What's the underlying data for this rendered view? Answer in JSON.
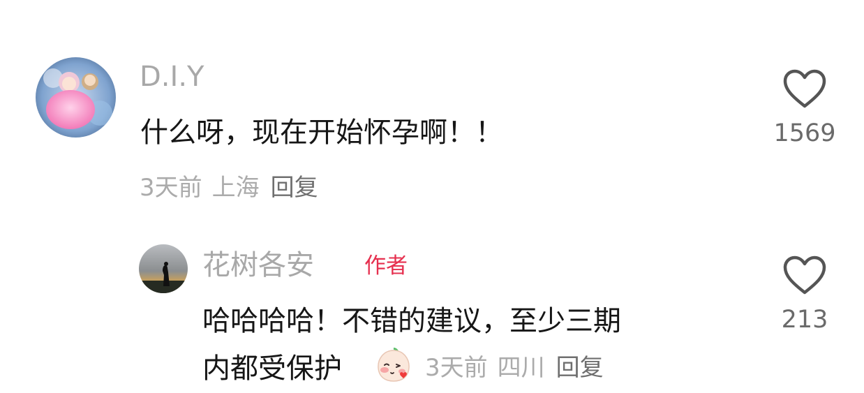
{
  "comments": [
    {
      "username": "D.I.Y",
      "text": "什么呀，现在开始怀孕啊！！",
      "time": "3天前",
      "location": "上海",
      "reply_label": "回复",
      "likes": "1569"
    }
  ],
  "reply": {
    "username": "花树各安",
    "badge": "作者",
    "text_line1": "哈哈哈哈！不错的建议，至少三期",
    "text_line2": "内都受保护",
    "time": "3天前",
    "location": "四川",
    "reply_label": "回复",
    "likes": "213"
  },
  "colors": {
    "badge": "#e6304f",
    "username": "#a8a8a8",
    "text": "#161616",
    "meta": "#ababab"
  },
  "icons": {
    "like": "heart-outline-icon",
    "emoji": "blushing-peach-emoji"
  }
}
